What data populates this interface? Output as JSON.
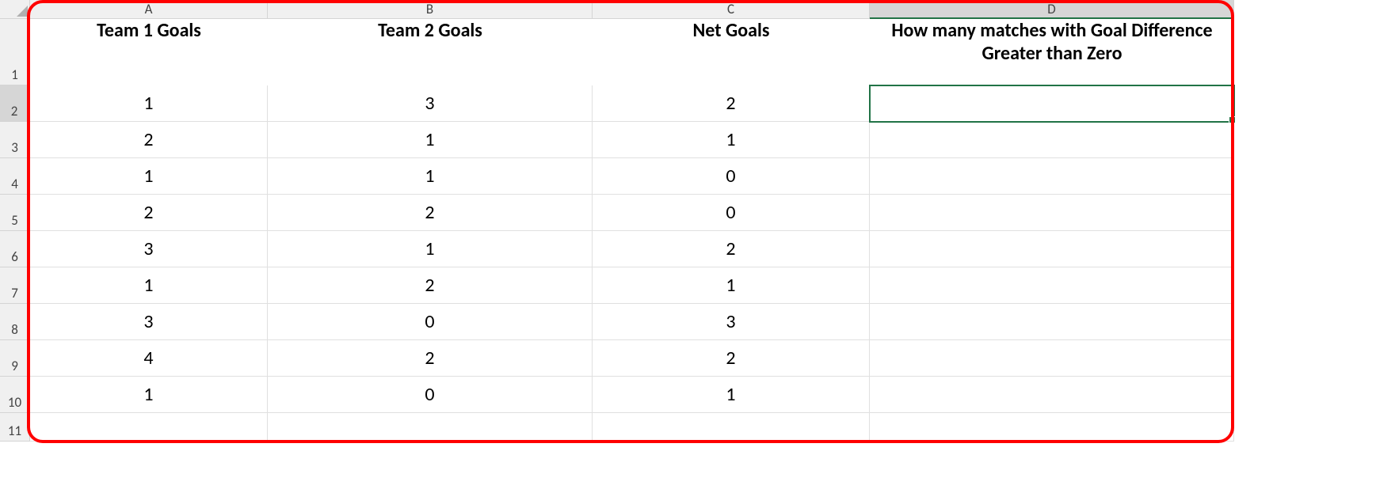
{
  "columns": [
    "A",
    "B",
    "C",
    "D"
  ],
  "rows": [
    "1",
    "2",
    "3",
    "4",
    "5",
    "6",
    "7",
    "8",
    "9",
    "10",
    "11"
  ],
  "headers": {
    "A": "Team 1 Goals",
    "B": "Team 2 Goals",
    "C": "Net Goals",
    "D": "How many matches with Goal Difference Greater than Zero"
  },
  "data": [
    {
      "A": "1",
      "B": "3",
      "C": "2",
      "D": ""
    },
    {
      "A": "2",
      "B": "1",
      "C": "1",
      "D": ""
    },
    {
      "A": "1",
      "B": "1",
      "C": "0",
      "D": ""
    },
    {
      "A": "2",
      "B": "2",
      "C": "0",
      "D": ""
    },
    {
      "A": "3",
      "B": "1",
      "C": "2",
      "D": ""
    },
    {
      "A": "1",
      "B": "2",
      "C": "1",
      "D": ""
    },
    {
      "A": "3",
      "B": "0",
      "C": "3",
      "D": ""
    },
    {
      "A": "4",
      "B": "2",
      "C": "2",
      "D": ""
    },
    {
      "A": "1",
      "B": "0",
      "C": "1",
      "D": ""
    }
  ],
  "selected_cell": "D2",
  "chart_data": {
    "type": "table",
    "title": "",
    "columns": [
      "Team 1 Goals",
      "Team 2 Goals",
      "Net Goals",
      "How many matches with Goal Difference Greater than Zero"
    ],
    "rows": [
      [
        1,
        3,
        2,
        null
      ],
      [
        2,
        1,
        1,
        null
      ],
      [
        1,
        1,
        0,
        null
      ],
      [
        2,
        2,
        0,
        null
      ],
      [
        3,
        1,
        2,
        null
      ],
      [
        1,
        2,
        1,
        null
      ],
      [
        3,
        0,
        3,
        null
      ],
      [
        4,
        2,
        2,
        null
      ],
      [
        1,
        0,
        1,
        null
      ]
    ]
  }
}
